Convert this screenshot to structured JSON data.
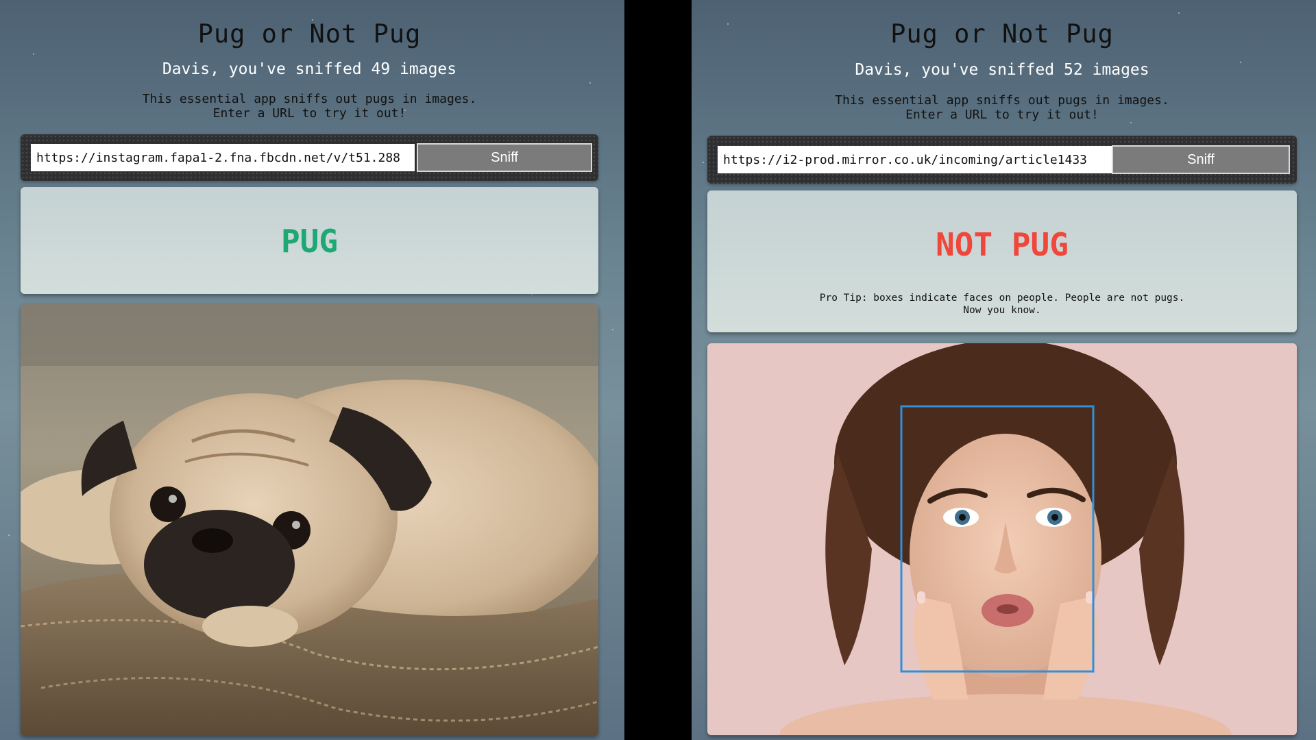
{
  "left": {
    "app_title": "Pug or Not Pug",
    "greeting": "Davis, you've sniffed 49 images",
    "description": "This essential app sniffs out pugs in images.\nEnter a URL to try it out!",
    "url_value": "https://instagram.fapa1-2.fna.fbcdn.net/v/t51.288",
    "button_label": "Sniff",
    "verdict": "PUG",
    "verdict_color": "#1fa774",
    "photo_subject": "pug-photo"
  },
  "right": {
    "app_title": "Pug or Not Pug",
    "greeting": "Davis, you've sniffed 52 images",
    "description": "This essential app sniffs out pugs in images.\nEnter a URL to try it out!",
    "url_value": "https://i2-prod.mirror.co.uk/incoming/article1433",
    "button_label": "Sniff",
    "verdict": "NOT PUG",
    "verdict_color": "#f0463c",
    "tip": "Pro Tip: boxes indicate faces on people. People are not pugs.\nNow you know.",
    "photo_subject": "woman-face-photo",
    "face_box_color": "#2f8fd8"
  }
}
